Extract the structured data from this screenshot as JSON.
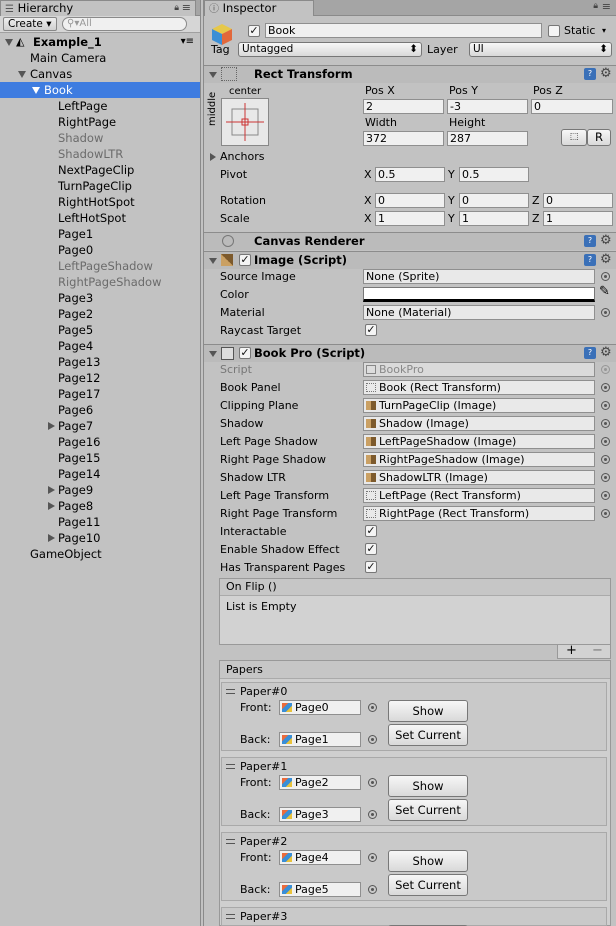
{
  "hierarchy": {
    "tab_label": "Hierarchy",
    "create_label": "Create",
    "search_placeholder": "All",
    "scene": "Example_1",
    "items": [
      {
        "label": "Main Camera"
      },
      {
        "label": "Canvas"
      },
      {
        "label": "Book"
      },
      {
        "label": "LeftPage"
      },
      {
        "label": "RightPage"
      },
      {
        "label": "Shadow"
      },
      {
        "label": "ShadowLTR"
      },
      {
        "label": "NextPageClip"
      },
      {
        "label": "TurnPageClip"
      },
      {
        "label": "RightHotSpot"
      },
      {
        "label": "LeftHotSpot"
      },
      {
        "label": "Page1"
      },
      {
        "label": "Page0"
      },
      {
        "label": "LeftPageShadow"
      },
      {
        "label": "RightPageShadow"
      },
      {
        "label": "Page3"
      },
      {
        "label": "Page2"
      },
      {
        "label": "Page5"
      },
      {
        "label": "Page4"
      },
      {
        "label": "Page13"
      },
      {
        "label": "Page12"
      },
      {
        "label": "Page17"
      },
      {
        "label": "Page6"
      },
      {
        "label": "Page7"
      },
      {
        "label": "Page16"
      },
      {
        "label": "Page15"
      },
      {
        "label": "Page14"
      },
      {
        "label": "Page9"
      },
      {
        "label": "Page8"
      },
      {
        "label": "Page11"
      },
      {
        "label": "Page10"
      },
      {
        "label": "GameObject"
      }
    ]
  },
  "inspector": {
    "tab_label": "Inspector",
    "object_name": "Book",
    "static_label": "Static",
    "tag_label": "Tag",
    "tag_value": "Untagged",
    "layer_label": "Layer",
    "layer_value": "UI",
    "rect_transform": {
      "title": "Rect Transform",
      "anchor_h": "center",
      "anchor_v": "middle",
      "posx_label": "Pos X",
      "posx": "2",
      "posy_label": "Pos Y",
      "posy": "-3",
      "posz_label": "Pos Z",
      "posz": "0",
      "width_label": "Width",
      "width": "372",
      "height_label": "Height",
      "height": "287",
      "r_label": "R",
      "anchors_label": "Anchors",
      "pivot_label": "Pivot",
      "pivot_x": "0.5",
      "pivot_y": "0.5",
      "rotation_label": "Rotation",
      "rot_x": "0",
      "rot_y": "0",
      "rot_z": "0",
      "scale_label": "Scale",
      "scale_x": "1",
      "scale_y": "1",
      "scale_z": "1",
      "x": "X",
      "y": "Y",
      "z": "Z"
    },
    "canvas_renderer": {
      "title": "Canvas Renderer"
    },
    "image": {
      "title": "Image (Script)",
      "source_image_label": "Source Image",
      "source_image": "None (Sprite)",
      "color_label": "Color",
      "material_label": "Material",
      "material": "None (Material)",
      "raycast_label": "Raycast Target"
    },
    "bookpro": {
      "title": "Book Pro (Script)",
      "fields": [
        {
          "label": "Script",
          "value": "BookPro",
          "icon": "scr"
        },
        {
          "label": "Book Panel",
          "value": "Book (Rect Transform)",
          "icon": "rt"
        },
        {
          "label": "Clipping Plane",
          "value": "TurnPageClip (Image)",
          "icon": "img"
        },
        {
          "label": "Shadow",
          "value": "Shadow (Image)",
          "icon": "img"
        },
        {
          "label": "Left Page Shadow",
          "value": "LeftPageShadow (Image)",
          "icon": "img"
        },
        {
          "label": "Right Page Shadow",
          "value": "RightPageShadow (Image)",
          "icon": "img"
        },
        {
          "label": "Shadow LTR",
          "value": "ShadowLTR (Image)",
          "icon": "img"
        },
        {
          "label": "Left Page Transform",
          "value": "LeftPage (Rect Transform)",
          "icon": "rt"
        },
        {
          "label": "Right Page Transform",
          "value": "RightPage (Rect Transform)",
          "icon": "rt"
        }
      ],
      "toggles": [
        "Interactable",
        "Enable Shadow Effect",
        "Has Transparent Pages"
      ],
      "onflip_title": "On Flip ()",
      "onflip_empty": "List is Empty",
      "papers_title": "Papers",
      "front_label": "Front:",
      "back_label": "Back:",
      "show_label": "Show",
      "set_current_label": "Set Current",
      "papers": [
        {
          "name": "Paper#0",
          "front": "Page0",
          "back": "Page1"
        },
        {
          "name": "Paper#1",
          "front": "Page2",
          "back": "Page3"
        },
        {
          "name": "Paper#2",
          "front": "Page4",
          "back": "Page5"
        },
        {
          "name": "Paper#3"
        }
      ]
    }
  },
  "colors": {
    "selection": "#3e7ce0",
    "panel": "#c2c2c2"
  }
}
